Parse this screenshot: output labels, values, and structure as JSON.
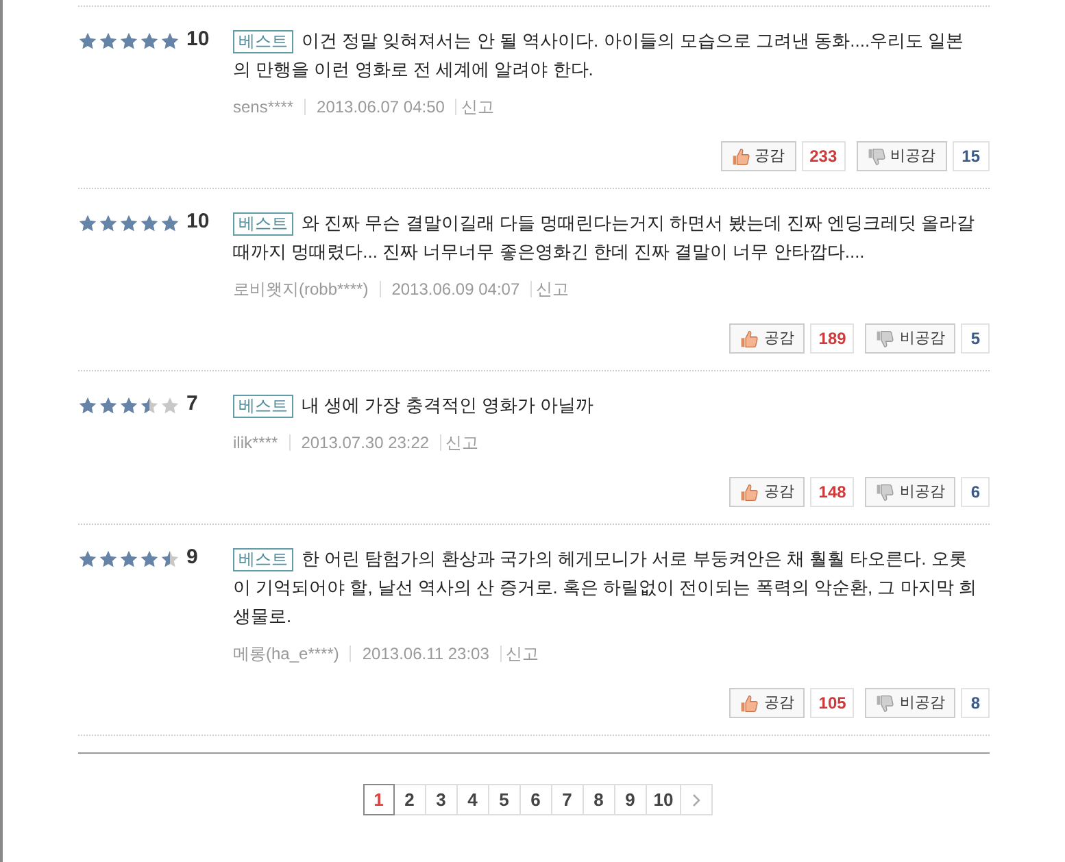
{
  "reviews": [
    {
      "stars": 5,
      "score": "10",
      "badge": "베스트",
      "text": "이건 정말 잊혀져서는 안 될 역사이다. 아이들의 모습으로 그려낸 동화....우리도 일본의 만행을 이런 영화로 전 세계에 알려야 한다.",
      "author": "sens****",
      "date": "2013.06.07 04:50",
      "report": "신고",
      "like_label": "공감",
      "likes": "233",
      "dislike_label": "비공감",
      "dislikes": "15"
    },
    {
      "stars": 5,
      "score": "10",
      "badge": "베스트",
      "text": "와 진짜 무슨 결말이길래 다들 멍때린다는거지 하면서 봤는데 진짜 엔딩크레딧 올라갈때까지 멍때렸다... 진짜 너무너무 좋은영화긴 한데 진짜 결말이 너무 안타깝다....",
      "author": "로비왯지(robb****)",
      "date": "2013.06.09 04:07",
      "report": "신고",
      "like_label": "공감",
      "likes": "189",
      "dislike_label": "비공감",
      "dislikes": "5"
    },
    {
      "stars": 3.5,
      "score": "7",
      "badge": "베스트",
      "text": "내 생에 가장 충격적인 영화가 아닐까",
      "author": "ilik****",
      "date": "2013.07.30 23:22",
      "report": "신고",
      "like_label": "공감",
      "likes": "148",
      "dislike_label": "비공감",
      "dislikes": "6"
    },
    {
      "stars": 4.5,
      "score": "9",
      "badge": "베스트",
      "text": "한 어린 탐험가의 환상과 국가의 헤게모니가 서로 부둥켜안은 채 훨훨 타오른다. 오롯이 기억되어야 할, 날선 역사의 산 증거로. 혹은 하릴없이 전이되는 폭력의 악순환, 그 마지막 희생물로.",
      "author": "메롱(ha_e****)",
      "date": "2013.06.11 23:03",
      "report": "신고",
      "like_label": "공감",
      "likes": "105",
      "dislike_label": "비공감",
      "dislikes": "8"
    }
  ],
  "pagination": {
    "pages": [
      {
        "label": "1",
        "selected": true
      },
      {
        "label": "2",
        "selected": false
      },
      {
        "label": "3",
        "selected": false
      },
      {
        "label": "4",
        "selected": false
      },
      {
        "label": "5",
        "selected": false
      },
      {
        "label": "6",
        "selected": false
      },
      {
        "label": "7",
        "selected": false
      },
      {
        "label": "8",
        "selected": false
      },
      {
        "label": "9",
        "selected": false
      },
      {
        "label": "10",
        "selected": false
      }
    ]
  }
}
